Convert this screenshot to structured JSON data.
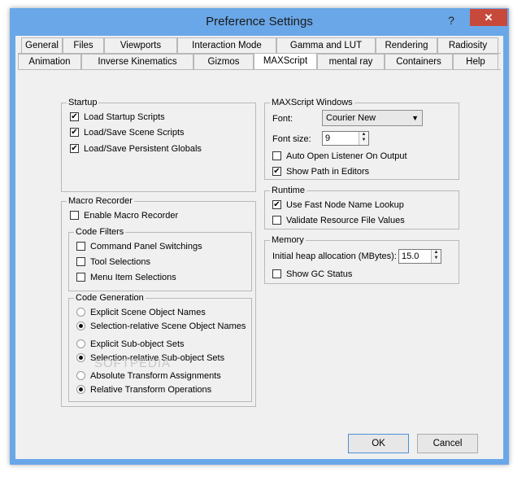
{
  "window": {
    "title": "Preference Settings",
    "help_label": "?",
    "close_label": "✕"
  },
  "tabs_row1": [
    "General",
    "Files",
    "Viewports",
    "Interaction Mode",
    "Gamma and LUT",
    "Rendering",
    "Radiosity"
  ],
  "tabs_row2": [
    "Animation",
    "Inverse Kinematics",
    "Gizmos",
    "MAXScript",
    "mental ray",
    "Containers",
    "Help"
  ],
  "active_tab": "MAXScript",
  "startup": {
    "legend": "Startup",
    "items": [
      {
        "label": "Load Startup Scripts",
        "checked": true
      },
      {
        "label": "Load/Save Scene Scripts",
        "checked": true
      },
      {
        "label": "Load/Save Persistent Globals",
        "checked": true
      }
    ]
  },
  "macro": {
    "legend": "Macro Recorder",
    "enable_label": "Enable Macro Recorder",
    "enable_checked": false,
    "filters": {
      "legend": "Code Filters",
      "items": [
        {
          "label": "Command Panel Switchings",
          "checked": false
        },
        {
          "label": "Tool Selections",
          "checked": false
        },
        {
          "label": "Menu Item Selections",
          "checked": false
        }
      ]
    },
    "generation": {
      "legend": "Code Generation",
      "items": [
        {
          "label": "Explicit Scene Object Names",
          "selected": false
        },
        {
          "label": "Selection-relative Scene Object Names",
          "selected": true
        },
        {
          "label": "Explicit Sub-object Sets",
          "selected": false
        },
        {
          "label": "Selection-relative Sub-object Sets",
          "selected": true
        },
        {
          "label": "Absolute Transform Assignments",
          "selected": false
        },
        {
          "label": "Relative Transform Operations",
          "selected": true
        }
      ]
    }
  },
  "maxscript_windows": {
    "legend": "MAXScript Windows",
    "font_label": "Font:",
    "font_value": "Courier New",
    "size_label": "Font size:",
    "size_value": "9",
    "auto_open_label": "Auto Open Listener On Output",
    "auto_open_checked": false,
    "show_path_label": "Show Path in Editors",
    "show_path_checked": true
  },
  "runtime": {
    "legend": "Runtime",
    "items": [
      {
        "label": "Use Fast Node Name Lookup",
        "checked": true
      },
      {
        "label": "Validate Resource File Values",
        "checked": false
      }
    ]
  },
  "memory": {
    "legend": "Memory",
    "heap_label": "Initial heap allocation (MBytes):",
    "heap_value": "15.0",
    "gc_label": "Show GC Status",
    "gc_checked": false
  },
  "buttons": {
    "ok": "OK",
    "cancel": "Cancel"
  },
  "watermark": "SOFTPEDIA",
  "checkmark": "✔"
}
